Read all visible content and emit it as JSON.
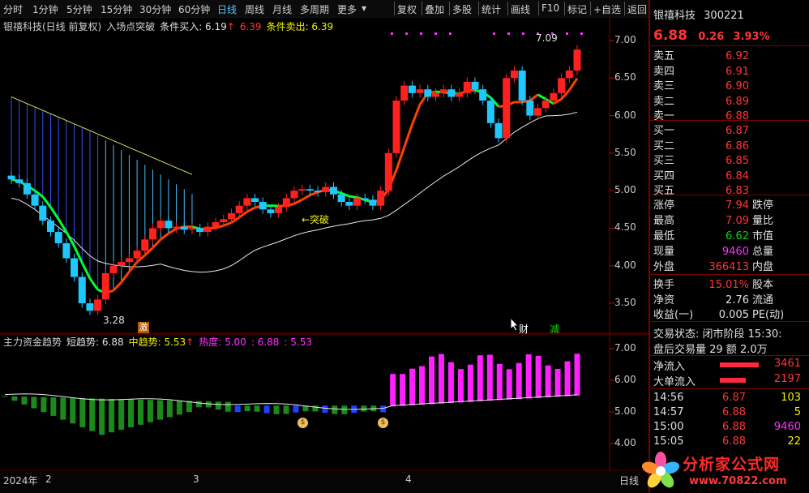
{
  "toolbar": {
    "items": [
      "分时",
      "1分钟",
      "5分钟",
      "15分钟",
      "30分钟",
      "60分钟",
      "日线",
      "周线",
      "月线",
      "多周期",
      "更多"
    ],
    "selected_index": 6,
    "right_items": [
      "复权",
      "叠加",
      "多股",
      "统计",
      "画线",
      "F10",
      "标记",
      "+自选",
      "返回"
    ]
  },
  "main_legend": {
    "title": "银禧科技(日线 前复权)",
    "indicator": "入场点突破",
    "buy_label": "条件买入: 6.19",
    "buy_up": "↑",
    "buy_val2": "6.39",
    "sell_label": "条件卖出: 6.39"
  },
  "main_axis": [
    "7.00",
    "6.50",
    "6.00",
    "5.50",
    "5.00",
    "4.50",
    "4.00",
    "3.50"
  ],
  "annotations": {
    "high_price": "7.09",
    "low_price": "3.28",
    "breakout": "←突破",
    "ji": "激",
    "cai": "财",
    "jian": "减"
  },
  "ind_legend": {
    "title": "主力资金趋势",
    "short": "短趋势: 6.88",
    "mid": "中趋势: 5.53",
    "mid_up": "↑",
    "heat": "热度: 5.00",
    "heat_v2": ": 6.88",
    "heat_v3": ": 5.53"
  },
  "ind_axis": [
    "7.00",
    "6.00",
    "5.00",
    "4.00"
  ],
  "bottom_axis": {
    "year": "2024年",
    "m2": "2",
    "m3": "3",
    "m4": "4",
    "period": "日线"
  },
  "panel": {
    "name": "银禧科技",
    "code": "300221",
    "price": "6.88",
    "change": "0.26",
    "pct": "3.93%",
    "asks": [
      {
        "label": "卖五",
        "price": "6.92"
      },
      {
        "label": "卖四",
        "price": "6.91"
      },
      {
        "label": "卖三",
        "price": "6.90"
      },
      {
        "label": "卖二",
        "price": "6.89"
      },
      {
        "label": "卖一",
        "price": "6.88"
      }
    ],
    "bids": [
      {
        "label": "买一",
        "price": "6.87"
      },
      {
        "label": "买二",
        "price": "6.86"
      },
      {
        "label": "买三",
        "price": "6.85"
      },
      {
        "label": "买四",
        "price": "6.84"
      },
      {
        "label": "买五",
        "price": "6.83"
      }
    ],
    "stats": [
      {
        "l1": "涨停",
        "v1": "7.94",
        "l2": "跌停"
      },
      {
        "l1": "最高",
        "v1": "7.09",
        "l2": "量比"
      },
      {
        "l1": "最低",
        "v1": "6.62",
        "l2": "市值"
      },
      {
        "l1": "现量",
        "v1": "9460",
        "l2": "总量"
      },
      {
        "l1": "外盘",
        "v1": "366413",
        "l2": "内盘"
      }
    ],
    "stats2": [
      {
        "l1": "换手",
        "v1": "15.01%",
        "l2": "股本"
      },
      {
        "l1": "净资",
        "v1": "2.76",
        "l2": "流通"
      },
      {
        "l1": "收益(一)",
        "v1": "0.005",
        "l2": "PE(动)"
      }
    ],
    "trade_state": "交易状态: 闭市阶段 15:30:",
    "after_hours": "盘后交易量 29 额 2.0万",
    "net_inflow": {
      "label": "净流入",
      "value": "3461"
    },
    "big_inflow": {
      "label": "大单流入",
      "value": "2197"
    },
    "ticks": [
      {
        "time": "14:56",
        "price": "6.87",
        "vol": "103"
      },
      {
        "time": "14:57",
        "price": "6.88",
        "vol": "5"
      },
      {
        "time": "15:00",
        "price": "6.88",
        "vol": "9460"
      },
      {
        "time": "15:05",
        "price": "6.88",
        "vol": "22"
      }
    ]
  },
  "logo": {
    "name": "分析家公式网",
    "url": "www.70822.com"
  },
  "colors": {
    "up": "#ff2020",
    "down": "#1ec8ff",
    "ma_up": "#ff4000",
    "ma_down": "#00ff30",
    "heat": "#ff20ff",
    "grid": "#5a0000"
  }
}
